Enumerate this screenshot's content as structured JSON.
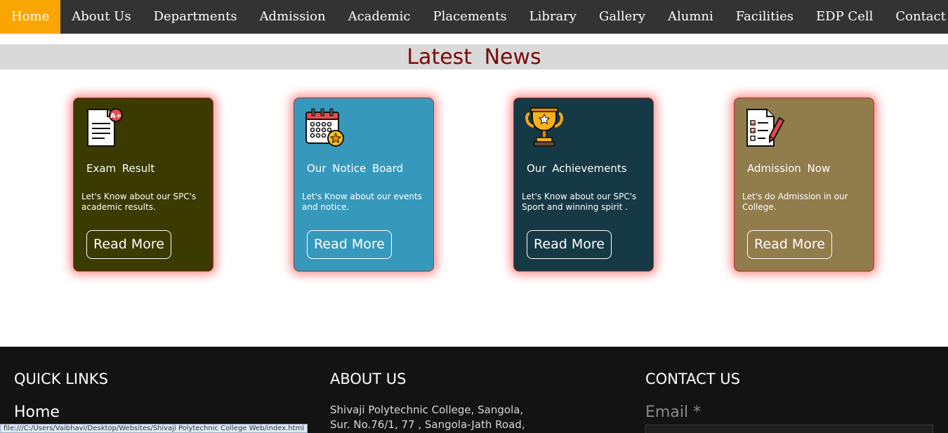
{
  "nav": {
    "items": [
      {
        "label": "Home",
        "active": true
      },
      {
        "label": "About Us"
      },
      {
        "label": "Departments"
      },
      {
        "label": "Admission"
      },
      {
        "label": "Academic"
      },
      {
        "label": "Placements"
      },
      {
        "label": "Library"
      },
      {
        "label": "Gallery"
      },
      {
        "label": "Alumni"
      },
      {
        "label": "Facilities"
      },
      {
        "label": "EDP Cell"
      },
      {
        "label": "Contact"
      }
    ],
    "active_color": "#f9a602",
    "bg_color": "#333333"
  },
  "news": {
    "title": "Latest  News",
    "title_color": "#7a0a0a"
  },
  "cards": [
    {
      "title": "Exam  Result",
      "text": "Let's Know about our SPC's academic results.",
      "button": "Read More",
      "bg": "#3b3a00",
      "icon": "exam-result-icon"
    },
    {
      "title": "Our  Notice  Board",
      "text": "Let's Know about our events and notice.",
      "button": "Read More",
      "bg": "#3699bc",
      "icon": "calendar-icon"
    },
    {
      "title": "Our  Achievements",
      "text": "Let's Know about our SPC's Sport and winning spirit .",
      "button": "Read More",
      "bg": "#153945",
      "icon": "trophy-icon"
    },
    {
      "title": "Admission  Now",
      "text": "Let's do Admission in our College.",
      "button": "Read More",
      "bg": "#917c4c",
      "icon": "admission-form-icon"
    }
  ],
  "footer": {
    "quick_links": {
      "heading": "QUICK LINKS",
      "items": [
        "Home"
      ]
    },
    "about": {
      "heading": "ABOUT US",
      "lines": [
        "Shivaji Polytechnic College, Sangola,",
        "Sur. No.76/1, 77 , Sangola-Jath Road,"
      ]
    },
    "contact": {
      "heading": "CONTACT US",
      "email_label": "Email *"
    }
  },
  "status_bar": "file:///C:/Users/Vaibhavi/Desktop/Websites/Shivaji Polytechnic College Web/index.html"
}
